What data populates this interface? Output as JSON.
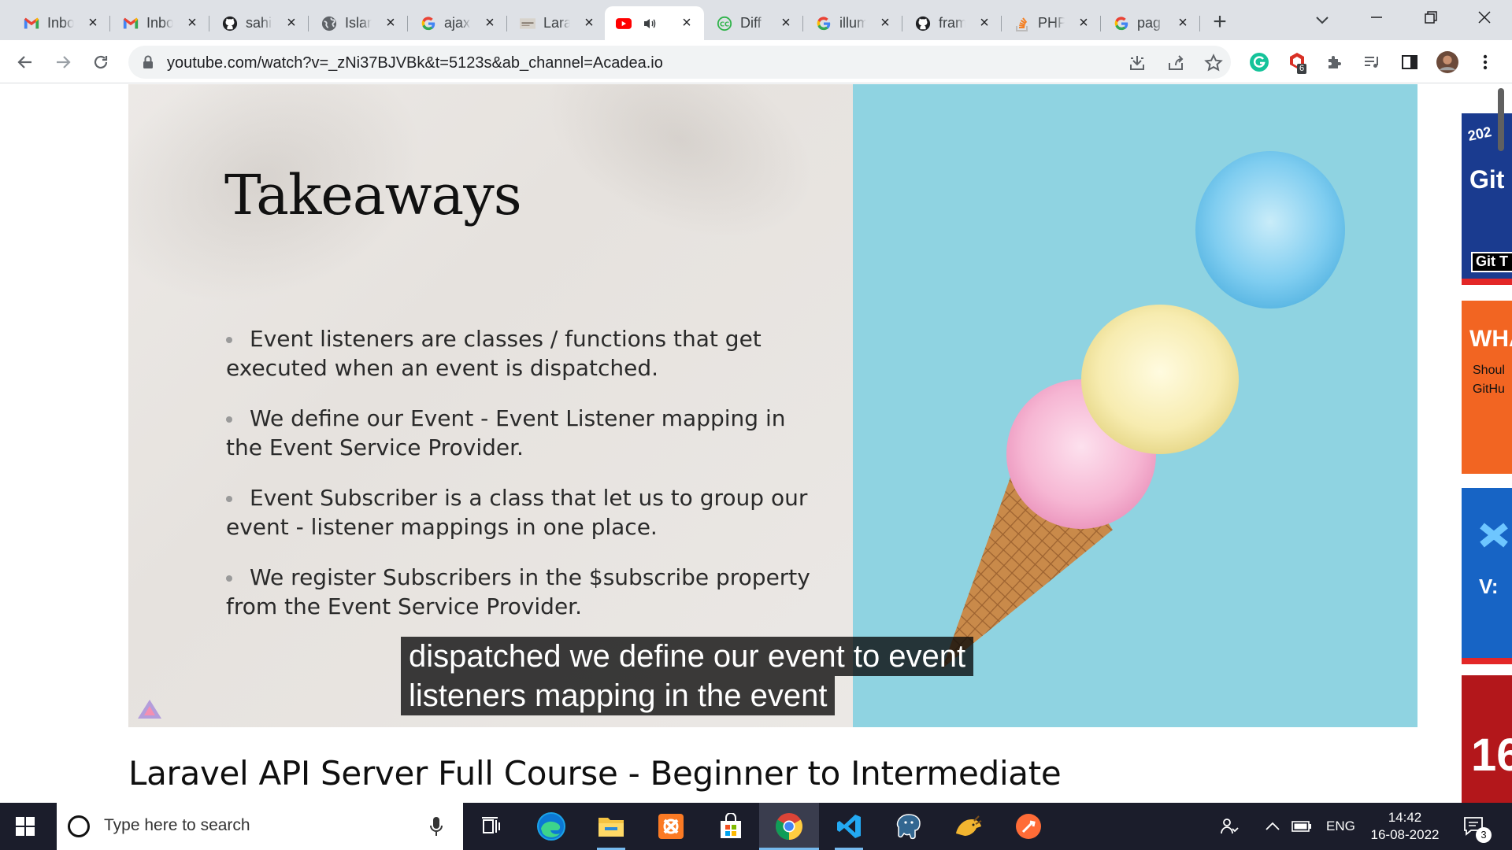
{
  "browser": {
    "tabs": [
      {
        "title": "Inbox",
        "icon": "gmail-icon",
        "active": false
      },
      {
        "title": "Inbox",
        "icon": "gmail-icon",
        "active": false
      },
      {
        "title": "sahil",
        "icon": "github-icon",
        "active": false
      },
      {
        "title": "Islam",
        "icon": "globe-icon",
        "active": false
      },
      {
        "title": "ajax",
        "icon": "google-icon",
        "active": false
      },
      {
        "title": "Lara",
        "icon": "laravel-doc-icon",
        "active": false
      },
      {
        "title": "",
        "icon": "youtube-icon",
        "active": true,
        "audio": true
      },
      {
        "title": "Diff",
        "icon": "diffchecker-icon",
        "active": false
      },
      {
        "title": "illum",
        "icon": "google-icon",
        "active": false
      },
      {
        "title": "fram",
        "icon": "github-icon",
        "active": false
      },
      {
        "title": "PHP",
        "icon": "stackoverflow-icon",
        "active": false
      },
      {
        "title": "pag",
        "icon": "google-icon",
        "active": false
      }
    ],
    "url": "youtube.com/watch?v=_zNi37BJVBk&t=5123s&ab_channel=Acadea.io",
    "extension_badge": "6"
  },
  "video": {
    "slide_title": "Takeaways",
    "bullets": [
      "Event listeners are classes / functions that get executed when an event is dispatched.",
      "We define our Event - Event Listener mapping in the Event Service Provider.",
      "Event Subscriber is a class that let us to group our event - listener mappings in one place.",
      "We register Subscribers in the $subscribe property from the Event Service Provider."
    ],
    "captions": [
      "dispatched we define our event to event",
      "listeners mapping in the event"
    ],
    "title": "Laravel API Server Full Course - Beginner to Intermediate"
  },
  "sidebar_thumbs": [
    {
      "lines": [
        "202",
        "Git",
        "Git T"
      ],
      "color": "#1a3b8f"
    },
    {
      "lines": [
        "WHA",
        "Shoul",
        "GitHu"
      ],
      "color": "#f26522"
    },
    {
      "lines": [
        "V:"
      ],
      "color": "#1764c5"
    },
    {
      "lines": [
        "16"
      ],
      "color": "#b3171b"
    }
  ],
  "taskbar": {
    "search_placeholder": "Type here to search",
    "apps": [
      "task-view-icon",
      "edge-icon",
      "file-explorer-icon",
      "xampp-icon",
      "store-icon",
      "chrome-icon",
      "vscode-icon",
      "postgres-icon",
      "dbeaver-icon",
      "postman-icon"
    ],
    "language": "ENG",
    "time": "14:42",
    "date": "16-08-2022",
    "notifications": "3"
  }
}
